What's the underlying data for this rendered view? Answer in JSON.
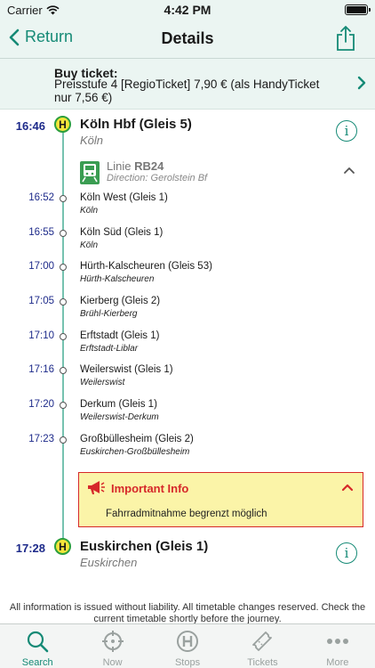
{
  "status_bar": {
    "carrier": "Carrier",
    "time": "4:42 PM"
  },
  "nav": {
    "back_label": "Return",
    "title": "Details"
  },
  "ticket": {
    "title": "Buy ticket:",
    "text": "Preisstufe 4 [RegioTicket] 7,90 € (als HandyTicket nur 7,56 €)"
  },
  "origin": {
    "time": "16:46",
    "name": "Köln Hbf (Gleis 5)",
    "city": "Köln"
  },
  "train": {
    "prefix": "Linie ",
    "line": "RB24",
    "direction": "Direction: Gerolstein Bf"
  },
  "stops": [
    {
      "time": "16:52",
      "name": "Köln West (Gleis 1)",
      "city": "Köln"
    },
    {
      "time": "16:55",
      "name": "Köln Süd (Gleis 1)",
      "city": "Köln"
    },
    {
      "time": "17:00",
      "name": "Hürth-Kalscheuren (Gleis 53)",
      "city": "Hürth-Kalscheuren"
    },
    {
      "time": "17:05",
      "name": "Kierberg (Gleis 2)",
      "city": "Brühl-Kierberg"
    },
    {
      "time": "17:10",
      "name": "Erftstadt (Gleis 1)",
      "city": "Erftstadt-Liblar"
    },
    {
      "time": "17:16",
      "name": "Weilerswist (Gleis 1)",
      "city": "Weilerswist"
    },
    {
      "time": "17:20",
      "name": "Derkum (Gleis 1)",
      "city": "Weilerswist-Derkum"
    },
    {
      "time": "17:23",
      "name": "Großbüllesheim (Gleis 2)",
      "city": "Euskirchen-Großbüllesheim"
    }
  ],
  "notice": {
    "title": "Important Info",
    "text": "Fahrradmitnahme begrenzt möglich"
  },
  "destination": {
    "time": "17:28",
    "name": "Euskirchen (Gleis 1)",
    "city": "Euskirchen"
  },
  "badge_letter": "H",
  "disclaimer": "All information is issued without liability. All timetable changes reserved. Check the current timetable shortly before the journey.",
  "tabs": [
    {
      "label": "Search",
      "icon": "search-icon",
      "active": true
    },
    {
      "label": "Now",
      "icon": "crosshair-icon",
      "active": false
    },
    {
      "label": "Stops",
      "icon": "stop-h-icon",
      "active": false
    },
    {
      "label": "Tickets",
      "icon": "ticket-icon",
      "active": false
    },
    {
      "label": "More",
      "icon": "more-icon",
      "active": false
    }
  ],
  "colors": {
    "accent": "#158a76",
    "time_blue": "#1d2a8a",
    "alert_red": "#d6282a",
    "notice_bg": "#fbf4a8",
    "header_bg": "#ebf5f2"
  }
}
